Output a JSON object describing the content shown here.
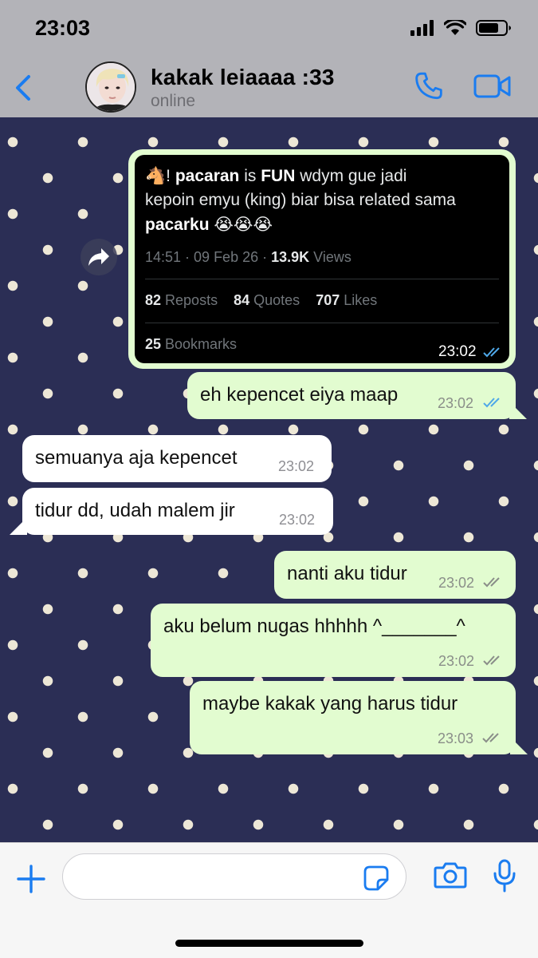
{
  "status_bar": {
    "time": "23:03"
  },
  "header": {
    "contact_name": "kakak leiaaaa :33",
    "contact_status": "online"
  },
  "tweet": {
    "line1_prefix": "🐴! ",
    "line1_bold1": "pacaran",
    "line1_mid": "  is ",
    "line1_bold2": "FUN",
    "line1_suffix": " wdym gue jadi",
    "line2": "kepoin emyu (king) biar bisa related sama",
    "line3_bold": "pacarku",
    "line3_suffix": " 😭😭😭",
    "meta_prefix": "14:51 · 09 Feb 26 · ",
    "meta_views_count": "13.9K",
    "meta_views_label": " Views",
    "reposts_count": "82",
    "reposts_label": " Reposts",
    "quotes_count": "84",
    "quotes_label": " Quotes",
    "likes_count": "707",
    "likes_label": " Likes",
    "bookmarks_count": "25",
    "bookmarks_label": " Bookmarks",
    "time": "23:02"
  },
  "messages": [
    {
      "text": "eh kepencet eiya maap",
      "time": "23:02"
    },
    {
      "text": "semuanya aja kepencet",
      "time": "23:02"
    },
    {
      "text": "tidur dd, udah malem jir",
      "time": "23:02"
    },
    {
      "text": "nanti aku tidur",
      "time": "23:02"
    },
    {
      "text": "aku belum nugas hhhhh ^_______^",
      "time": "23:02"
    },
    {
      "text": "maybe kakak yang harus tidur",
      "time": "23:03"
    }
  ],
  "composer": {
    "placeholder": ""
  },
  "colors": {
    "accent": "#1a7cf0",
    "header_bg": "#b3b3b8",
    "outgoing_bubble": "#e2fcd0",
    "incoming_bubble": "#ffffff",
    "chat_bg": "#2b2e55",
    "dot": "#ede7d6",
    "read_ticks": "#4fa8e8"
  }
}
